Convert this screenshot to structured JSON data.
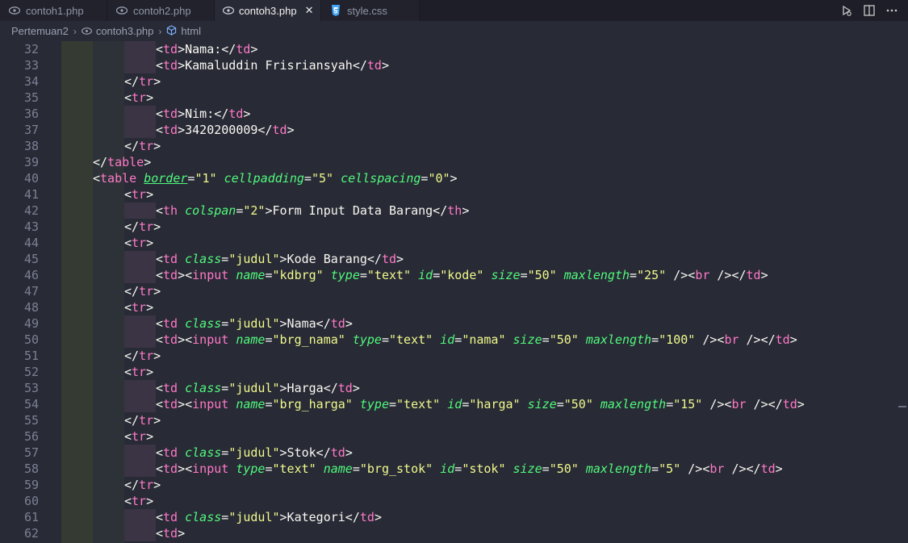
{
  "tabs": [
    {
      "label": "contoh1.php",
      "icon": "php-icon",
      "active": false
    },
    {
      "label": "contoh2.php",
      "icon": "php-icon",
      "active": false
    },
    {
      "label": "contoh3.php",
      "icon": "php-icon",
      "active": true,
      "close": "✕"
    },
    {
      "label": "style.css",
      "icon": "css-icon",
      "active": false
    }
  ],
  "breadcrumb": {
    "folder": "Pertemuan2",
    "file": "contoh3.php",
    "symbol": "html"
  },
  "line_numbers": [
    "32",
    "33",
    "34",
    "35",
    "36",
    "37",
    "38",
    "39",
    "40",
    "41",
    "42",
    "43",
    "44",
    "45",
    "46",
    "47",
    "48",
    "49",
    "50",
    "51",
    "52",
    "53",
    "54",
    "55",
    "56",
    "57",
    "58",
    "59",
    "60",
    "61",
    "62"
  ],
  "code_lines": [
    [
      [
        2,
        "t",
        "<td"
      ],
      [
        2,
        "p",
        ">"
      ],
      [
        0,
        "p",
        "Nama:"
      ],
      [
        0,
        "t",
        "</td"
      ],
      [
        0,
        "p",
        ">"
      ]
    ],
    [
      [
        2,
        "t",
        "<td"
      ],
      [
        0,
        "p",
        ">"
      ],
      [
        0,
        "p",
        "Kamaluddin Frisriansyah"
      ],
      [
        0,
        "t",
        "</td"
      ],
      [
        0,
        "p",
        ">"
      ]
    ],
    [
      [
        1,
        "p",
        "</"
      ],
      [
        0,
        "t",
        "tr"
      ],
      [
        0,
        "p",
        ">"
      ]
    ],
    [
      [
        1,
        "p",
        "<"
      ],
      [
        0,
        "t",
        "tr"
      ],
      [
        0,
        "p",
        ">"
      ]
    ],
    [
      [
        2,
        "p",
        "<"
      ],
      [
        0,
        "t",
        "td"
      ],
      [
        0,
        "p",
        ">Nim:</"
      ],
      [
        0,
        "t",
        "td"
      ],
      [
        0,
        "p",
        ">"
      ]
    ],
    [
      [
        2,
        "p",
        "<"
      ],
      [
        0,
        "t",
        "td"
      ],
      [
        0,
        "p",
        ">3420200009</"
      ],
      [
        0,
        "t",
        "td"
      ],
      [
        0,
        "p",
        ">"
      ]
    ],
    [
      [
        1,
        "p",
        "</"
      ],
      [
        0,
        "t",
        "tr"
      ],
      [
        0,
        "p",
        ">"
      ]
    ],
    [
      [
        1,
        "p",
        "</"
      ],
      [
        0,
        "t",
        "table"
      ],
      [
        0,
        "p",
        ">"
      ]
    ]
  ],
  "code": [
    {
      "i": 3,
      "parts": [
        [
          "p",
          "<"
        ],
        [
          "t",
          "td"
        ],
        [
          "p",
          ">Nama:</"
        ],
        [
          "t",
          "td"
        ],
        [
          "p",
          ">"
        ]
      ]
    },
    {
      "i": 3,
      "parts": [
        [
          "p",
          "<"
        ],
        [
          "t",
          "td"
        ],
        [
          "p",
          ">Kamaluddin Frisriansyah</"
        ],
        [
          "t",
          "td"
        ],
        [
          "p",
          ">"
        ]
      ]
    },
    {
      "i": 2,
      "parts": [
        [
          "p",
          "</"
        ],
        [
          "t",
          "tr"
        ],
        [
          "p",
          ">"
        ]
      ]
    },
    {
      "i": 2,
      "parts": [
        [
          "p",
          "<"
        ],
        [
          "t",
          "tr"
        ],
        [
          "p",
          ">"
        ]
      ]
    },
    {
      "i": 3,
      "parts": [
        [
          "p",
          "<"
        ],
        [
          "t",
          "td"
        ],
        [
          "p",
          ">Nim:</"
        ],
        [
          "t",
          "td"
        ],
        [
          "p",
          ">"
        ]
      ]
    },
    {
      "i": 3,
      "parts": [
        [
          "p",
          "<"
        ],
        [
          "t",
          "td"
        ],
        [
          "p",
          ">3420200009</"
        ],
        [
          "t",
          "td"
        ],
        [
          "p",
          ">"
        ]
      ]
    },
    {
      "i": 2,
      "parts": [
        [
          "p",
          "</"
        ],
        [
          "t",
          "tr"
        ],
        [
          "p",
          ">"
        ]
      ]
    },
    {
      "i": 1,
      "parts": [
        [
          "p",
          "</"
        ],
        [
          "t",
          "table"
        ],
        [
          "p",
          ">"
        ]
      ]
    },
    {
      "i": 1,
      "parts": [
        [
          "p",
          "<"
        ],
        [
          "t",
          "table"
        ],
        [
          "p",
          " "
        ],
        [
          "au",
          "border"
        ],
        [
          "p",
          "="
        ],
        [
          "s",
          "\"1\""
        ],
        [
          "p",
          " "
        ],
        [
          "a",
          "cellpadding"
        ],
        [
          "p",
          "="
        ],
        [
          "s",
          "\"5\""
        ],
        [
          "p",
          " "
        ],
        [
          "a",
          "cellspacing"
        ],
        [
          "p",
          "="
        ],
        [
          "s",
          "\"0\""
        ],
        [
          "p",
          ">"
        ]
      ]
    },
    {
      "i": 2,
      "parts": [
        [
          "p",
          "<"
        ],
        [
          "t",
          "tr"
        ],
        [
          "p",
          ">"
        ]
      ]
    },
    {
      "i": 3,
      "parts": [
        [
          "p",
          "<"
        ],
        [
          "t",
          "th"
        ],
        [
          "p",
          " "
        ],
        [
          "a",
          "colspan"
        ],
        [
          "p",
          "="
        ],
        [
          "s",
          "\"2\""
        ],
        [
          "p",
          ">Form Input Data Barang</"
        ],
        [
          "t",
          "th"
        ],
        [
          "p",
          ">"
        ]
      ]
    },
    {
      "i": 2,
      "parts": [
        [
          "p",
          "</"
        ],
        [
          "t",
          "tr"
        ],
        [
          "p",
          ">"
        ]
      ]
    },
    {
      "i": 2,
      "parts": [
        [
          "p",
          "<"
        ],
        [
          "t",
          "tr"
        ],
        [
          "p",
          ">"
        ]
      ]
    },
    {
      "i": 3,
      "parts": [
        [
          "p",
          "<"
        ],
        [
          "t",
          "td"
        ],
        [
          "p",
          " "
        ],
        [
          "a",
          "class"
        ],
        [
          "p",
          "="
        ],
        [
          "s",
          "\"judul\""
        ],
        [
          "p",
          ">Kode Barang</"
        ],
        [
          "t",
          "td"
        ],
        [
          "p",
          ">"
        ]
      ]
    },
    {
      "i": 3,
      "parts": [
        [
          "p",
          "<"
        ],
        [
          "t",
          "td"
        ],
        [
          "p",
          "><"
        ],
        [
          "t",
          "input"
        ],
        [
          "p",
          " "
        ],
        [
          "a",
          "name"
        ],
        [
          "p",
          "="
        ],
        [
          "s",
          "\"kdbrg\""
        ],
        [
          "p",
          " "
        ],
        [
          "a",
          "type"
        ],
        [
          "p",
          "="
        ],
        [
          "s",
          "\"text\""
        ],
        [
          "p",
          " "
        ],
        [
          "a",
          "id"
        ],
        [
          "p",
          "="
        ],
        [
          "s",
          "\"kode\""
        ],
        [
          "p",
          " "
        ],
        [
          "a",
          "size"
        ],
        [
          "p",
          "="
        ],
        [
          "s",
          "\"50\""
        ],
        [
          "p",
          " "
        ],
        [
          "a",
          "maxlength"
        ],
        [
          "p",
          "="
        ],
        [
          "s",
          "\"25\""
        ],
        [
          "p",
          " /><"
        ],
        [
          "t",
          "br"
        ],
        [
          "p",
          " /></"
        ],
        [
          "t",
          "td"
        ],
        [
          "p",
          ">"
        ]
      ]
    },
    {
      "i": 2,
      "parts": [
        [
          "p",
          "</"
        ],
        [
          "t",
          "tr"
        ],
        [
          "p",
          ">"
        ]
      ]
    },
    {
      "i": 2,
      "parts": [
        [
          "p",
          "<"
        ],
        [
          "t",
          "tr"
        ],
        [
          "p",
          ">"
        ]
      ]
    },
    {
      "i": 3,
      "parts": [
        [
          "p",
          "<"
        ],
        [
          "t",
          "td"
        ],
        [
          "p",
          " "
        ],
        [
          "a",
          "class"
        ],
        [
          "p",
          "="
        ],
        [
          "s",
          "\"judul\""
        ],
        [
          "p",
          ">Nama</"
        ],
        [
          "t",
          "td"
        ],
        [
          "p",
          ">"
        ]
      ]
    },
    {
      "i": 3,
      "parts": [
        [
          "p",
          "<"
        ],
        [
          "t",
          "td"
        ],
        [
          "p",
          "><"
        ],
        [
          "t",
          "input"
        ],
        [
          "p",
          " "
        ],
        [
          "a",
          "name"
        ],
        [
          "p",
          "="
        ],
        [
          "s",
          "\"brg_nama\""
        ],
        [
          "p",
          " "
        ],
        [
          "a",
          "type"
        ],
        [
          "p",
          "="
        ],
        [
          "s",
          "\"text\""
        ],
        [
          "p",
          " "
        ],
        [
          "a",
          "id"
        ],
        [
          "p",
          "="
        ],
        [
          "s",
          "\"nama\""
        ],
        [
          "p",
          " "
        ],
        [
          "a",
          "size"
        ],
        [
          "p",
          "="
        ],
        [
          "s",
          "\"50\""
        ],
        [
          "p",
          " "
        ],
        [
          "a",
          "maxlength"
        ],
        [
          "p",
          "="
        ],
        [
          "s",
          "\"100\""
        ],
        [
          "p",
          " /><"
        ],
        [
          "t",
          "br"
        ],
        [
          "p",
          " /></"
        ],
        [
          "t",
          "td"
        ],
        [
          "p",
          ">"
        ]
      ]
    },
    {
      "i": 2,
      "parts": [
        [
          "p",
          "</"
        ],
        [
          "t",
          "tr"
        ],
        [
          "p",
          ">"
        ]
      ]
    },
    {
      "i": 2,
      "parts": [
        [
          "p",
          "<"
        ],
        [
          "t",
          "tr"
        ],
        [
          "p",
          ">"
        ]
      ]
    },
    {
      "i": 3,
      "parts": [
        [
          "p",
          "<"
        ],
        [
          "t",
          "td"
        ],
        [
          "p",
          " "
        ],
        [
          "a",
          "class"
        ],
        [
          "p",
          "="
        ],
        [
          "s",
          "\"judul\""
        ],
        [
          "p",
          ">Harga</"
        ],
        [
          "t",
          "td"
        ],
        [
          "p",
          ">"
        ]
      ]
    },
    {
      "i": 3,
      "parts": [
        [
          "p",
          "<"
        ],
        [
          "t",
          "td"
        ],
        [
          "p",
          "><"
        ],
        [
          "t",
          "input"
        ],
        [
          "p",
          " "
        ],
        [
          "a",
          "name"
        ],
        [
          "p",
          "="
        ],
        [
          "s",
          "\"brg_harga\""
        ],
        [
          "p",
          " "
        ],
        [
          "a",
          "type"
        ],
        [
          "p",
          "="
        ],
        [
          "s",
          "\"text\""
        ],
        [
          "p",
          " "
        ],
        [
          "a",
          "id"
        ],
        [
          "p",
          "="
        ],
        [
          "s",
          "\"harga\""
        ],
        [
          "p",
          " "
        ],
        [
          "a",
          "size"
        ],
        [
          "p",
          "="
        ],
        [
          "s",
          "\"50\""
        ],
        [
          "p",
          " "
        ],
        [
          "a",
          "maxlength"
        ],
        [
          "p",
          "="
        ],
        [
          "s",
          "\"15\""
        ],
        [
          "p",
          " /><"
        ],
        [
          "t",
          "br"
        ],
        [
          "p",
          " /></"
        ],
        [
          "t",
          "td"
        ],
        [
          "p",
          ">"
        ]
      ]
    },
    {
      "i": 2,
      "parts": [
        [
          "p",
          "</"
        ],
        [
          "t",
          "tr"
        ],
        [
          "p",
          ">"
        ]
      ]
    },
    {
      "i": 2,
      "parts": [
        [
          "p",
          "<"
        ],
        [
          "t",
          "tr"
        ],
        [
          "p",
          ">"
        ]
      ]
    },
    {
      "i": 3,
      "parts": [
        [
          "p",
          "<"
        ],
        [
          "t",
          "td"
        ],
        [
          "p",
          " "
        ],
        [
          "a",
          "class"
        ],
        [
          "p",
          "="
        ],
        [
          "s",
          "\"judul\""
        ],
        [
          "p",
          ">Stok</"
        ],
        [
          "t",
          "td"
        ],
        [
          "p",
          ">"
        ]
      ]
    },
    {
      "i": 3,
      "parts": [
        [
          "p",
          "<"
        ],
        [
          "t",
          "td"
        ],
        [
          "p",
          "><"
        ],
        [
          "t",
          "input"
        ],
        [
          "p",
          " "
        ],
        [
          "a",
          "type"
        ],
        [
          "p",
          "="
        ],
        [
          "s",
          "\"text\""
        ],
        [
          "p",
          " "
        ],
        [
          "a",
          "name"
        ],
        [
          "p",
          "="
        ],
        [
          "s",
          "\"brg_stok\""
        ],
        [
          "p",
          " "
        ],
        [
          "a",
          "id"
        ],
        [
          "p",
          "="
        ],
        [
          "s",
          "\"stok\""
        ],
        [
          "p",
          " "
        ],
        [
          "a",
          "size"
        ],
        [
          "p",
          "="
        ],
        [
          "s",
          "\"50\""
        ],
        [
          "p",
          " "
        ],
        [
          "a",
          "maxlength"
        ],
        [
          "p",
          "="
        ],
        [
          "s",
          "\"5\""
        ],
        [
          "p",
          " /><"
        ],
        [
          "t",
          "br"
        ],
        [
          "p",
          " /></"
        ],
        [
          "t",
          "td"
        ],
        [
          "p",
          ">"
        ]
      ]
    },
    {
      "i": 2,
      "parts": [
        [
          "p",
          "</"
        ],
        [
          "t",
          "tr"
        ],
        [
          "p",
          ">"
        ]
      ]
    },
    {
      "i": 2,
      "parts": [
        [
          "p",
          "<"
        ],
        [
          "t",
          "tr"
        ],
        [
          "p",
          ">"
        ]
      ]
    },
    {
      "i": 3,
      "parts": [
        [
          "p",
          "<"
        ],
        [
          "t",
          "td"
        ],
        [
          "p",
          " "
        ],
        [
          "a",
          "class"
        ],
        [
          "p",
          "="
        ],
        [
          "s",
          "\"judul\""
        ],
        [
          "p",
          ">Kategori</"
        ],
        [
          "t",
          "td"
        ],
        [
          "p",
          ">"
        ]
      ]
    },
    {
      "i": 3,
      "parts": [
        [
          "p",
          "<"
        ],
        [
          "t",
          "td"
        ],
        [
          "p",
          ">"
        ]
      ]
    }
  ],
  "colors": {
    "background": "#282a36",
    "tag": "#ff79c6",
    "attribute": "#50fa7b",
    "string": "#f1fa8c",
    "text": "#f8f8f2"
  }
}
